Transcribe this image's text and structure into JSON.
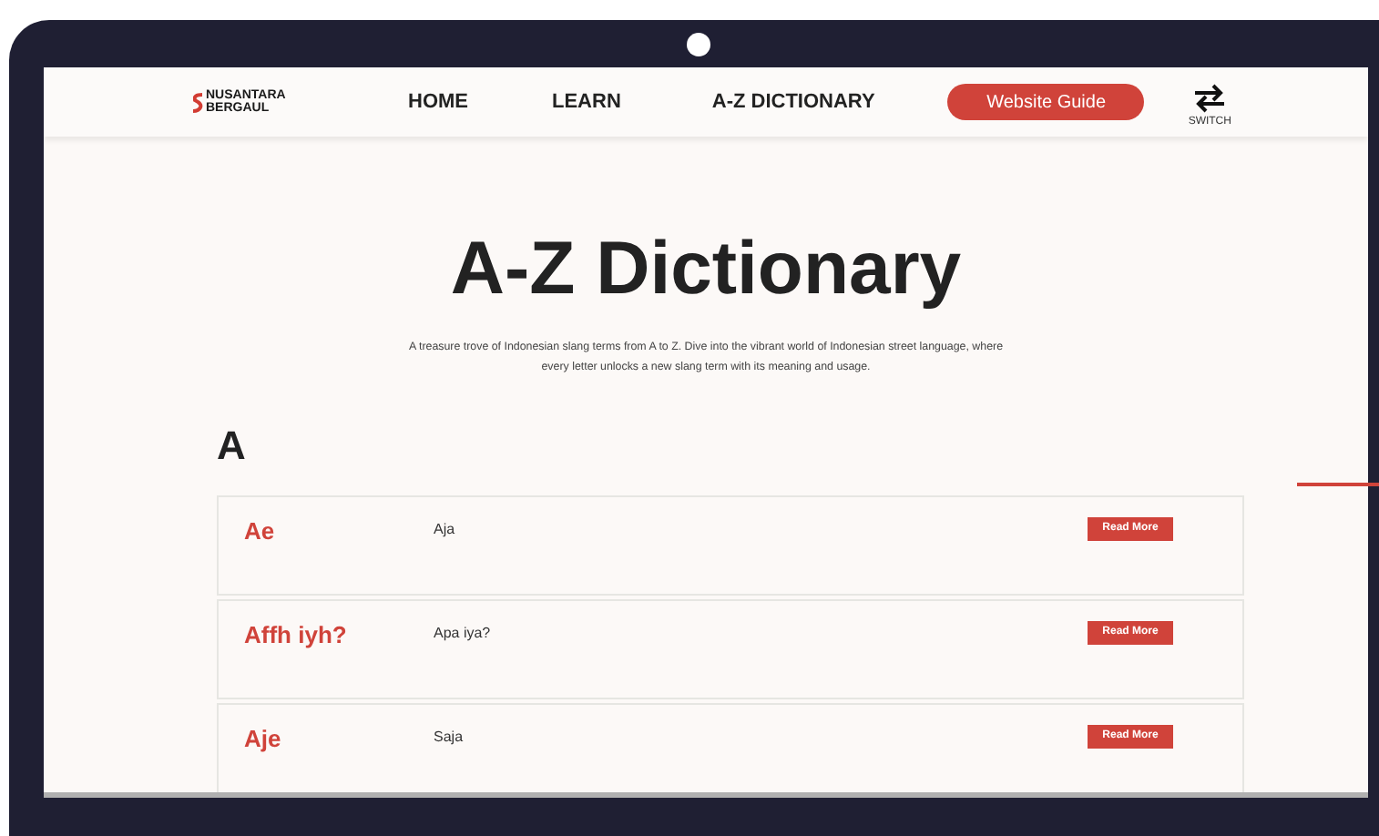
{
  "brand": {
    "line_1": "NUSANTARA",
    "line_2": "BERGAUL"
  },
  "nav": [
    {
      "label": "HOME"
    },
    {
      "label": "LEARN"
    },
    {
      "label": "A-Z DICTIONARY"
    }
  ],
  "guide_button": "Website Guide",
  "switch_label": "SWITCH",
  "title": "A-Z Dictionary",
  "subtitle": "A treasure trove of Indonesian slang terms from A to Z. Dive into the vibrant world of Indonesian street language, where every letter unlocks a new slang term with its meaning and usage.",
  "letter": "A",
  "entries": [
    {
      "term": "Ae",
      "meaning": "Aja",
      "action": "Read More"
    },
    {
      "term": "Affh iyh?",
      "meaning": "Apa iya?",
      "action": "Read More"
    },
    {
      "term": "Aje",
      "meaning": "Saja",
      "action": "Read More"
    }
  ]
}
